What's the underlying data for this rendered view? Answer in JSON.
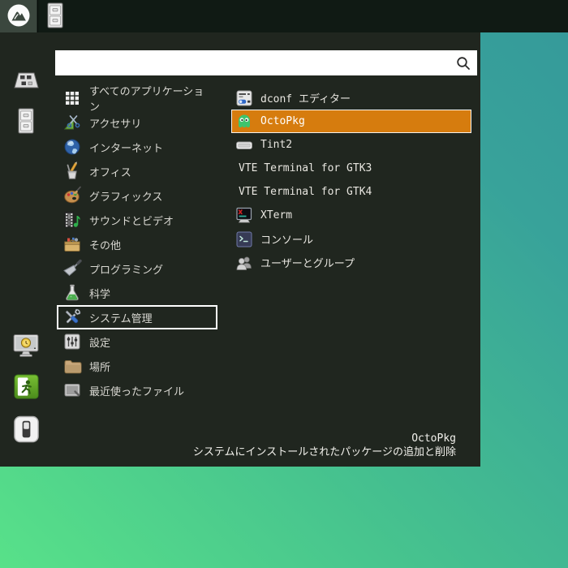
{
  "colors": {
    "desktop_gradient_start": "#58e189",
    "desktop_gradient_end": "#35999a",
    "taskbar_bg": "#101a14",
    "menu_bg": "#20261f",
    "selection_orange": "#d67c0e",
    "selection_border": "#ffffff"
  },
  "taskbar": {
    "buttons": [
      {
        "name": "app-menu",
        "icon": "distro-logo-icon"
      },
      {
        "name": "file-manager",
        "icon": "file-cabinet-icon"
      }
    ]
  },
  "menu": {
    "search": {
      "value": "",
      "icon": "search-icon"
    },
    "rail": [
      {
        "icon": "control-panel-icon"
      },
      {
        "icon": "file-cabinet-icon"
      },
      {
        "icon": "display-clock-icon"
      },
      {
        "icon": "logout-icon"
      },
      {
        "icon": "power-icon"
      }
    ],
    "categories": [
      {
        "label": "すべてのアプリケーション",
        "icon": "all-apps-grid-icon",
        "selected": false
      },
      {
        "label": "アクセサリ",
        "icon": "accessories-icon",
        "selected": false
      },
      {
        "label": "インターネット",
        "icon": "globe-icon",
        "selected": false
      },
      {
        "label": "オフィス",
        "icon": "office-icon",
        "selected": false
      },
      {
        "label": "グラフィックス",
        "icon": "graphics-palette-icon",
        "selected": false
      },
      {
        "label": "サウンドとビデオ",
        "icon": "sound-video-icon",
        "selected": false
      },
      {
        "label": "その他",
        "icon": "toolbox-icon",
        "selected": false
      },
      {
        "label": "プログラミング",
        "icon": "programming-icon",
        "selected": false
      },
      {
        "label": "科学",
        "icon": "science-flask-icon",
        "selected": false
      },
      {
        "label": "システム管理",
        "icon": "system-tools-icon",
        "selected": true
      },
      {
        "label": "設定",
        "icon": "settings-icon",
        "selected": false
      },
      {
        "label": "場所",
        "icon": "folder-icon",
        "selected": false
      },
      {
        "label": "最近使ったファイル",
        "icon": "recent-files-icon",
        "selected": false
      }
    ],
    "apps": [
      {
        "label": "dconf エディター",
        "icon": "dconf-editor-icon",
        "selected": false
      },
      {
        "label": "OctoPkg",
        "icon": "octopkg-icon",
        "selected": true
      },
      {
        "label": "Tint2",
        "icon": "tint2-icon",
        "selected": false
      },
      {
        "label": "VTE Terminal for GTK3",
        "icon": null,
        "selected": false
      },
      {
        "label": "VTE Terminal for GTK4",
        "icon": null,
        "selected": false
      },
      {
        "label": "XTerm",
        "icon": "xterm-icon",
        "selected": false
      },
      {
        "label": "コンソール",
        "icon": "console-icon",
        "selected": false
      },
      {
        "label": "ユーザーとグループ",
        "icon": "users-groups-icon",
        "selected": false
      }
    ],
    "footer": {
      "title": "OctoPkg",
      "description": "システムにインストールされたパッケージの追加と削除"
    }
  }
}
